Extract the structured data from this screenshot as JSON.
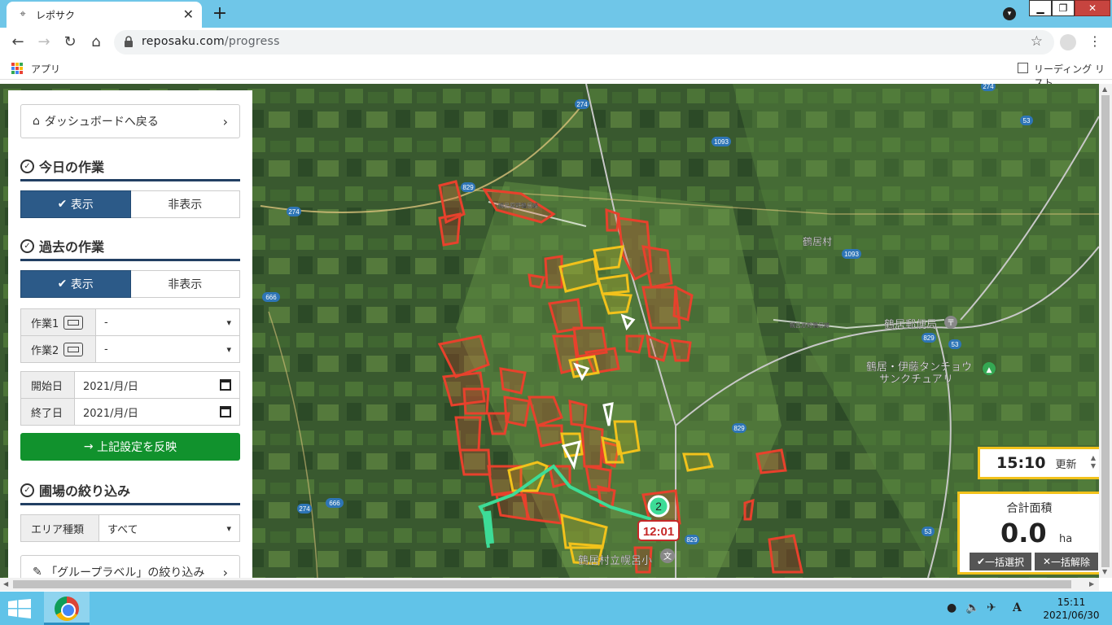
{
  "browser": {
    "tab_title": "レポサク",
    "url_domain": "reposaku.com",
    "url_path": "/progress",
    "bookmark_apps": "アプリ",
    "reading_list": "リーディング リスト"
  },
  "sidebar": {
    "back_label": "ダッシュボードへ戻る",
    "today_heading": "今日の作業",
    "today_show": "表示",
    "today_hide": "非表示",
    "past_heading": "過去の作業",
    "past_show": "表示",
    "past_hide": "非表示",
    "work1_label": "作業1",
    "work1_value": "-",
    "work2_label": "作業2",
    "work2_value": "-",
    "start_label": "開始日",
    "start_value": "2021/月/日",
    "end_label": "終了日",
    "end_value": "2021/月/日",
    "apply_label": "上記設定を反映",
    "field_heading": "圃場の絞り込み",
    "area_type_label": "エリア種類",
    "area_type_value": "すべて",
    "group_label": "「グループラベル」の絞り込み"
  },
  "map": {
    "labels": {
      "village": "鶴居村",
      "post_office": "鶴居郵便局",
      "sanctuary_1": "鶴居・伊藤タンチョウ",
      "sanctuary_2": "サンクチュアリ",
      "school": "鶴居村立幌呂小",
      "road_a": "幌呂原野鶴居線",
      "road_b": "幌呂原野鶴居線"
    },
    "route_shields": [
      "274",
      "274",
      "274",
      "274",
      "1093",
      "1093",
      "829",
      "829",
      "829",
      "829",
      "53",
      "53",
      "53",
      "666",
      "666"
    ],
    "marker_count": "2",
    "marker_time": "12:01",
    "colors": {
      "worked": "#e8412c",
      "past": "#f2c21b",
      "route": "#3ddc97"
    }
  },
  "panel": {
    "time": "15:10",
    "update_label": "更新",
    "area_title": "合計面積",
    "area_value": "0.0",
    "area_unit": "ha",
    "select_all": "一括選択",
    "deselect_all": "一括解除"
  },
  "taskbar": {
    "clock_time": "15:11",
    "clock_date": "2021/06/30"
  }
}
